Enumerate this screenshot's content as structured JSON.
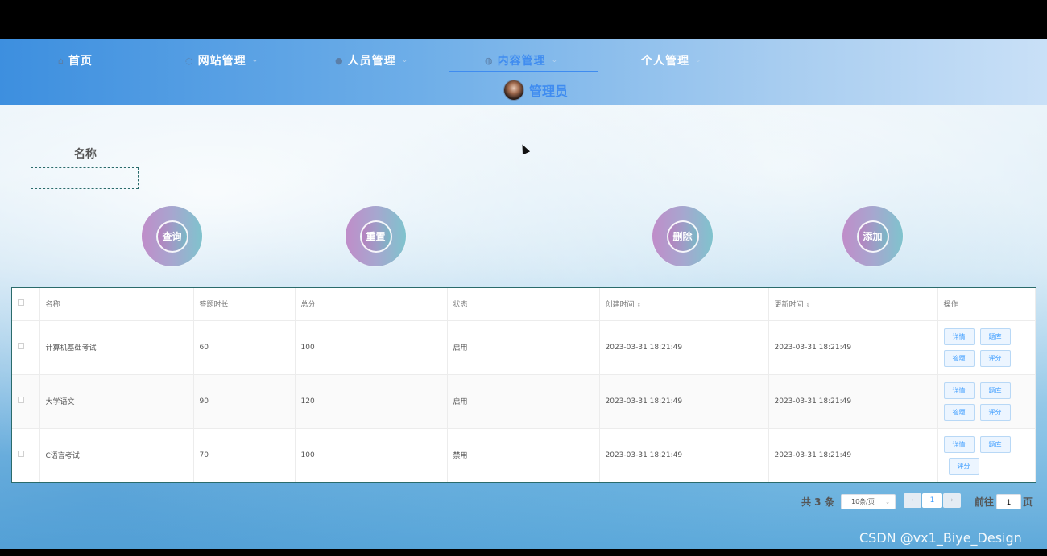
{
  "nav": {
    "items": [
      {
        "label": "首页",
        "icon": "home-icon",
        "glyph": "⌂",
        "chevron": false
      },
      {
        "label": "网站管理",
        "icon": "globe-icon",
        "glyph": "◌",
        "chevron": true
      },
      {
        "label": "人员管理",
        "icon": "user-icon",
        "glyph": "●",
        "chevron": true
      },
      {
        "label": "内容管理",
        "icon": "chat-icon",
        "glyph": "◍",
        "chevron": true
      },
      {
        "label": "个人管理",
        "icon": "",
        "glyph": "",
        "chevron": true
      }
    ],
    "active_index": 3,
    "user": {
      "name": "管理员",
      "avatar": "avatar-photo"
    }
  },
  "search": {
    "label": "名称",
    "value": "",
    "placeholder": ""
  },
  "actions": {
    "query": "查询",
    "reset": "重置",
    "delete": "删除",
    "add": "添加"
  },
  "table": {
    "headers": [
      "名称",
      "答题时长",
      "总分",
      "状态",
      "创建时间",
      "更新时间",
      "操作"
    ],
    "sortable": [
      "创建时间",
      "更新时间"
    ],
    "rows": [
      {
        "name": "计算机基础考试",
        "duration": "60",
        "total": "100",
        "status": "启用",
        "created": "2023-03-31 18:21:49",
        "updated": "2023-03-31 18:21:49",
        "ops": [
          "详情",
          "题库",
          "答题",
          "评分"
        ]
      },
      {
        "name": "大学语文",
        "duration": "90",
        "total": "120",
        "status": "启用",
        "created": "2023-03-31 18:21:49",
        "updated": "2023-03-31 18:21:49",
        "ops": [
          "详情",
          "题库",
          "答题",
          "评分"
        ]
      },
      {
        "name": "C语言考试",
        "duration": "70",
        "total": "100",
        "status": "禁用",
        "created": "2023-03-31 18:21:49",
        "updated": "2023-03-31 18:21:49",
        "ops": [
          "详情",
          "题库",
          "评分"
        ]
      }
    ]
  },
  "pagination": {
    "total_text": "共 3 条",
    "page_size": "10条/页",
    "prev": "‹",
    "next": "›",
    "current_page": "1",
    "goto_label": "前往",
    "goto_value": "1",
    "goto_suffix": "页"
  },
  "watermark": "CSDN @vx1_Biye_Design",
  "colors": {
    "accent": "#3f8cf0",
    "table_border": "#2a6b6b",
    "op_button_text": "#409eff"
  }
}
